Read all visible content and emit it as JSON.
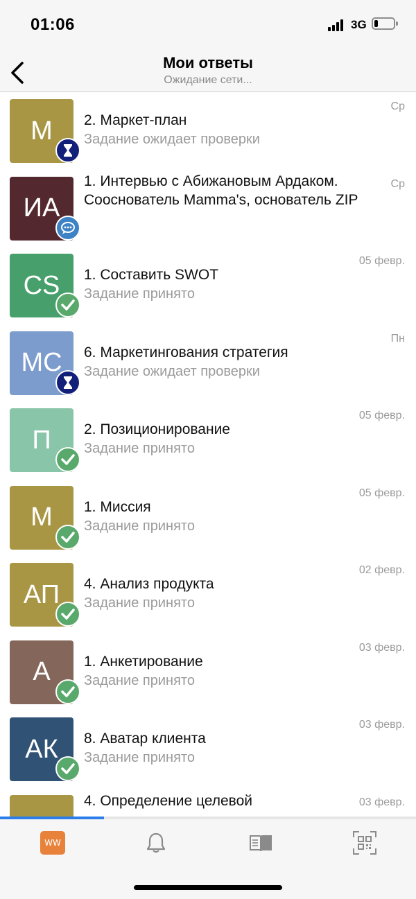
{
  "status_bar": {
    "time": "01:06",
    "network": "3G",
    "battery_level": 0.2
  },
  "nav": {
    "title": "Мои ответы",
    "subtitle": "Ожидание сети..."
  },
  "items": [
    {
      "initials": "М",
      "color": "#a89645",
      "title": "2. Маркет-план",
      "status": "Задание ожидает проверки",
      "date": "Ср",
      "badge": "hourglass-icon"
    },
    {
      "initials": "ИА",
      "color": "#53292f",
      "title": "1. Интервью с Абижановым Ардаком. Сооснователь Mamma's, основатель ZIP",
      "status": "",
      "date": "Ср",
      "badge": "chat-icon"
    },
    {
      "initials": "CS",
      "color": "#47a06b",
      "title": "1. Составить SWOT",
      "status": "Задание принято",
      "date": "05 февр.",
      "badge": "check-icon"
    },
    {
      "initials": "МС",
      "color": "#7b9ccd",
      "title": "6. Маркетингования стратегия",
      "status": "Задание ожидает проверки",
      "date": "Пн",
      "badge": "hourglass-icon"
    },
    {
      "initials": "П",
      "color": "#89c5a9",
      "title": "2. Позиционирование",
      "status": "Задание принято",
      "date": "05 февр.",
      "badge": "check-icon"
    },
    {
      "initials": "М",
      "color": "#a89645",
      "title": "1. Миссия",
      "status": "Задание принято",
      "date": "05 февр.",
      "badge": "check-icon"
    },
    {
      "initials": "АП",
      "color": "#a89645",
      "title": "4. Анализ продукта",
      "status": "Задание принято",
      "date": "02 февр.",
      "badge": "check-icon"
    },
    {
      "initials": "А",
      "color": "#85665a",
      "title": "1. Анкетирование",
      "status": "Задание принято",
      "date": "03 февр.",
      "badge": "check-icon"
    },
    {
      "initials": "АК",
      "color": "#2f5275",
      "title": "8. Аватар клиента",
      "status": "Задание принято",
      "date": "03 февр.",
      "badge": "check-icon"
    },
    {
      "initials": "",
      "color": "#a89645",
      "title": "4. Определение целевой",
      "status": "",
      "date": "03 февр.",
      "badge": ""
    }
  ],
  "tab_bar": {
    "tabs": [
      {
        "name": "tab-home",
        "label": "WW",
        "icon": "ww-logo"
      },
      {
        "name": "tab-notifications",
        "icon": "bell-icon"
      },
      {
        "name": "tab-library",
        "icon": "book-icon"
      },
      {
        "name": "tab-qr",
        "icon": "qr-code-icon"
      }
    ],
    "loading_progress": 0.25
  },
  "colors": {
    "accent": "#2b7de9",
    "check": "#5aa96c",
    "hourglass": "#13207a",
    "chat": "#3d82c4"
  }
}
